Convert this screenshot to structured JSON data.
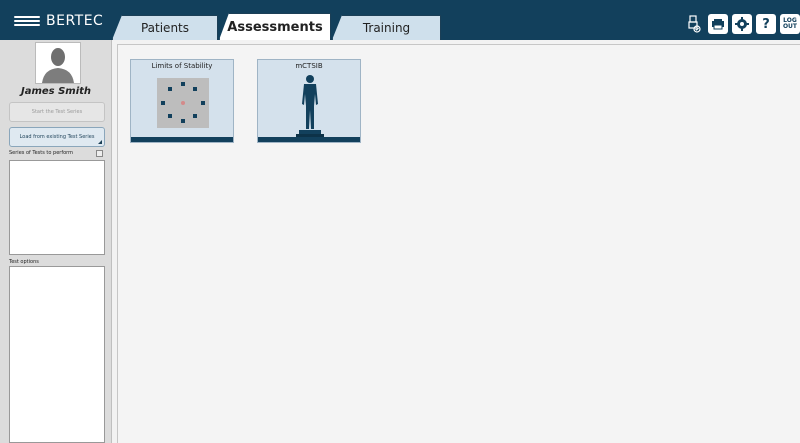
{
  "app": {
    "brand": "BERTEC"
  },
  "tabs": [
    {
      "label": "Patients",
      "active": false
    },
    {
      "label": "Assessments",
      "active": true
    },
    {
      "label": "Training",
      "active": false
    }
  ],
  "toolbar": {
    "icons": [
      "usb-device-icon",
      "printer-icon",
      "settings-icon",
      "help-icon",
      "logout-icon"
    ],
    "help_glyph": "?",
    "logout_label": {
      "line1": "LOG",
      "line2": "OUT"
    }
  },
  "sidebar": {
    "patient_name": "James Smith",
    "start_button": "Start the Test Series",
    "load_button": "Load from existing Test Series",
    "series_label": "Series of Tests to perform",
    "options_label": "Test options"
  },
  "assessments": [
    {
      "title": "Limits of Stability",
      "icon": "limits-of-stability-target-icon"
    },
    {
      "title": "mCTSIB",
      "icon": "standing-person-icon"
    }
  ],
  "colors": {
    "header": "#12405c",
    "tab_inactive": "#cfe0ec",
    "card": "#d4e1ec",
    "target_marker": "#12405c"
  }
}
